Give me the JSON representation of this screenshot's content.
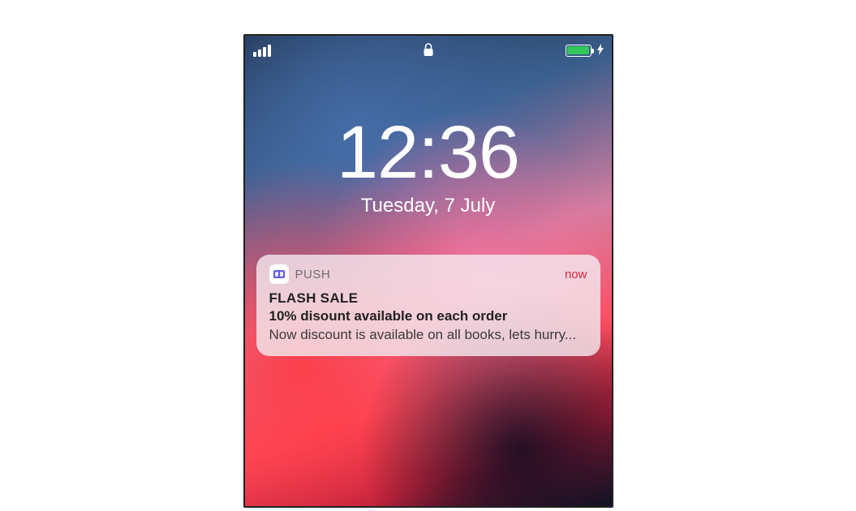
{
  "status": {
    "signal_icon": "cell-signal-icon",
    "lock_icon": "lock-icon",
    "battery_icon": "battery-icon",
    "charging_icon": "bolt-icon"
  },
  "lockscreen": {
    "time": "12:36",
    "date": "Tuesday, 7 July"
  },
  "notification": {
    "app_icon": "push-app-icon",
    "app_name": "PUSH",
    "timestamp": "now",
    "title": "FLASH SALE",
    "subtitle": "10% disount available on each order",
    "body": "Now discount is available on all books, lets hurry..."
  }
}
